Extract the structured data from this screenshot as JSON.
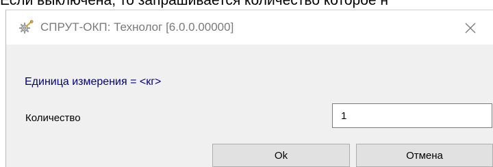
{
  "background_text": "Если выключена, то запрашивается количество которое н",
  "window": {
    "title": "СПРУТ-ОКП: Технолог [6.0.0.00000]",
    "app_icon": "gear-wrench-icon",
    "close_icon": "close-icon"
  },
  "form": {
    "unit_label": "Единица измерения = <кг>",
    "quantity_label": "Количество",
    "quantity_value": "1"
  },
  "buttons": {
    "ok_label": "Ok",
    "cancel_label": "Отмена"
  },
  "colors": {
    "unit_label": "#00007a",
    "content_background": "#f0f0f0",
    "button_background": "#e1e1e1",
    "title_text": "#7a7a7a"
  }
}
